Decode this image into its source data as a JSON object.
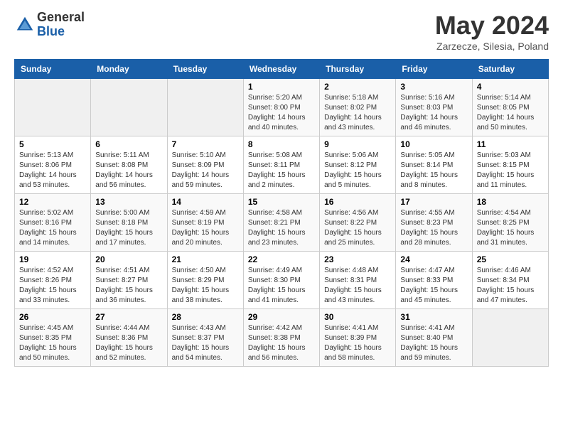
{
  "header": {
    "logo_general": "General",
    "logo_blue": "Blue",
    "month_title": "May 2024",
    "location": "Zarzecze, Silesia, Poland"
  },
  "weekdays": [
    "Sunday",
    "Monday",
    "Tuesday",
    "Wednesday",
    "Thursday",
    "Friday",
    "Saturday"
  ],
  "weeks": [
    [
      {
        "day": "",
        "empty": true
      },
      {
        "day": "",
        "empty": true
      },
      {
        "day": "",
        "empty": true
      },
      {
        "day": "1",
        "sunrise": "Sunrise: 5:20 AM",
        "sunset": "Sunset: 8:00 PM",
        "daylight": "Daylight: 14 hours and 40 minutes."
      },
      {
        "day": "2",
        "sunrise": "Sunrise: 5:18 AM",
        "sunset": "Sunset: 8:02 PM",
        "daylight": "Daylight: 14 hours and 43 minutes."
      },
      {
        "day": "3",
        "sunrise": "Sunrise: 5:16 AM",
        "sunset": "Sunset: 8:03 PM",
        "daylight": "Daylight: 14 hours and 46 minutes."
      },
      {
        "day": "4",
        "sunrise": "Sunrise: 5:14 AM",
        "sunset": "Sunset: 8:05 PM",
        "daylight": "Daylight: 14 hours and 50 minutes."
      }
    ],
    [
      {
        "day": "5",
        "sunrise": "Sunrise: 5:13 AM",
        "sunset": "Sunset: 8:06 PM",
        "daylight": "Daylight: 14 hours and 53 minutes."
      },
      {
        "day": "6",
        "sunrise": "Sunrise: 5:11 AM",
        "sunset": "Sunset: 8:08 PM",
        "daylight": "Daylight: 14 hours and 56 minutes."
      },
      {
        "day": "7",
        "sunrise": "Sunrise: 5:10 AM",
        "sunset": "Sunset: 8:09 PM",
        "daylight": "Daylight: 14 hours and 59 minutes."
      },
      {
        "day": "8",
        "sunrise": "Sunrise: 5:08 AM",
        "sunset": "Sunset: 8:11 PM",
        "daylight": "Daylight: 15 hours and 2 minutes."
      },
      {
        "day": "9",
        "sunrise": "Sunrise: 5:06 AM",
        "sunset": "Sunset: 8:12 PM",
        "daylight": "Daylight: 15 hours and 5 minutes."
      },
      {
        "day": "10",
        "sunrise": "Sunrise: 5:05 AM",
        "sunset": "Sunset: 8:14 PM",
        "daylight": "Daylight: 15 hours and 8 minutes."
      },
      {
        "day": "11",
        "sunrise": "Sunrise: 5:03 AM",
        "sunset": "Sunset: 8:15 PM",
        "daylight": "Daylight: 15 hours and 11 minutes."
      }
    ],
    [
      {
        "day": "12",
        "sunrise": "Sunrise: 5:02 AM",
        "sunset": "Sunset: 8:16 PM",
        "daylight": "Daylight: 15 hours and 14 minutes."
      },
      {
        "day": "13",
        "sunrise": "Sunrise: 5:00 AM",
        "sunset": "Sunset: 8:18 PM",
        "daylight": "Daylight: 15 hours and 17 minutes."
      },
      {
        "day": "14",
        "sunrise": "Sunrise: 4:59 AM",
        "sunset": "Sunset: 8:19 PM",
        "daylight": "Daylight: 15 hours and 20 minutes."
      },
      {
        "day": "15",
        "sunrise": "Sunrise: 4:58 AM",
        "sunset": "Sunset: 8:21 PM",
        "daylight": "Daylight: 15 hours and 23 minutes."
      },
      {
        "day": "16",
        "sunrise": "Sunrise: 4:56 AM",
        "sunset": "Sunset: 8:22 PM",
        "daylight": "Daylight: 15 hours and 25 minutes."
      },
      {
        "day": "17",
        "sunrise": "Sunrise: 4:55 AM",
        "sunset": "Sunset: 8:23 PM",
        "daylight": "Daylight: 15 hours and 28 minutes."
      },
      {
        "day": "18",
        "sunrise": "Sunrise: 4:54 AM",
        "sunset": "Sunset: 8:25 PM",
        "daylight": "Daylight: 15 hours and 31 minutes."
      }
    ],
    [
      {
        "day": "19",
        "sunrise": "Sunrise: 4:52 AM",
        "sunset": "Sunset: 8:26 PM",
        "daylight": "Daylight: 15 hours and 33 minutes."
      },
      {
        "day": "20",
        "sunrise": "Sunrise: 4:51 AM",
        "sunset": "Sunset: 8:27 PM",
        "daylight": "Daylight: 15 hours and 36 minutes."
      },
      {
        "day": "21",
        "sunrise": "Sunrise: 4:50 AM",
        "sunset": "Sunset: 8:29 PM",
        "daylight": "Daylight: 15 hours and 38 minutes."
      },
      {
        "day": "22",
        "sunrise": "Sunrise: 4:49 AM",
        "sunset": "Sunset: 8:30 PM",
        "daylight": "Daylight: 15 hours and 41 minutes."
      },
      {
        "day": "23",
        "sunrise": "Sunrise: 4:48 AM",
        "sunset": "Sunset: 8:31 PM",
        "daylight": "Daylight: 15 hours and 43 minutes."
      },
      {
        "day": "24",
        "sunrise": "Sunrise: 4:47 AM",
        "sunset": "Sunset: 8:33 PM",
        "daylight": "Daylight: 15 hours and 45 minutes."
      },
      {
        "day": "25",
        "sunrise": "Sunrise: 4:46 AM",
        "sunset": "Sunset: 8:34 PM",
        "daylight": "Daylight: 15 hours and 47 minutes."
      }
    ],
    [
      {
        "day": "26",
        "sunrise": "Sunrise: 4:45 AM",
        "sunset": "Sunset: 8:35 PM",
        "daylight": "Daylight: 15 hours and 50 minutes."
      },
      {
        "day": "27",
        "sunrise": "Sunrise: 4:44 AM",
        "sunset": "Sunset: 8:36 PM",
        "daylight": "Daylight: 15 hours and 52 minutes."
      },
      {
        "day": "28",
        "sunrise": "Sunrise: 4:43 AM",
        "sunset": "Sunset: 8:37 PM",
        "daylight": "Daylight: 15 hours and 54 minutes."
      },
      {
        "day": "29",
        "sunrise": "Sunrise: 4:42 AM",
        "sunset": "Sunset: 8:38 PM",
        "daylight": "Daylight: 15 hours and 56 minutes."
      },
      {
        "day": "30",
        "sunrise": "Sunrise: 4:41 AM",
        "sunset": "Sunset: 8:39 PM",
        "daylight": "Daylight: 15 hours and 58 minutes."
      },
      {
        "day": "31",
        "sunrise": "Sunrise: 4:41 AM",
        "sunset": "Sunset: 8:40 PM",
        "daylight": "Daylight: 15 hours and 59 minutes."
      },
      {
        "day": "",
        "empty": true
      }
    ]
  ]
}
